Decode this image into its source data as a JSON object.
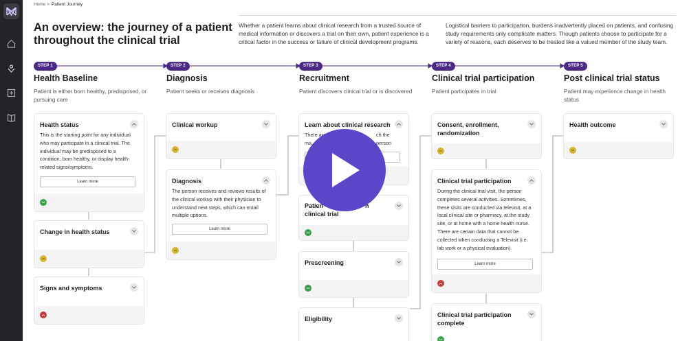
{
  "breadcrumb": {
    "home": "Home >",
    "current": "Patient Journey"
  },
  "header": {
    "title": "An overview: the journey of a patient throughout the clinical trial",
    "intro1": "Whether a patient learns about clinical research from a trusted source of medical information or discovers a trial on their own, patient experience is a critical factor in the success or failure of clinical development programs.",
    "intro2": "Logistical barriers to participation, burdens inadvertently placed on patients, and confusing study requirements only complicate matters. Though patients choose to participate for a variety of reasons, each deserves to be treated like a valued member of the study team."
  },
  "steps": [
    {
      "badge": "STEP 1",
      "title": "Health Baseline",
      "desc": "Patient is either born healthy, predisposed, or pursuing care"
    },
    {
      "badge": "STEP 2",
      "title": "Diagnosis",
      "desc": "Patient seeks or receives diagnosis"
    },
    {
      "badge": "STEP 3",
      "title": "Recruitment",
      "desc": "Patient discovers clinical trial or is discovered"
    },
    {
      "badge": "STEP 4",
      "title": "Clinical trial participation",
      "desc": "Patient participates in trial"
    },
    {
      "badge": "STEP 5",
      "title": "Post clinical trial status",
      "desc": "Patient may experience change in health status"
    }
  ],
  "cards": {
    "health_status": {
      "title": "Health status",
      "body": "This is the starting point for any individual who may participate in a clinical trial. The individual may be predisposed to a condition, born healthy, or display health-related signs/symptoms.",
      "learn": "Learn more",
      "mood": "good"
    },
    "change_health": {
      "title": "Change in health status",
      "mood": "neutral"
    },
    "signs_symptoms": {
      "title": "Signs and symptoms",
      "mood": "bad"
    },
    "clinical_workup": {
      "title": "Clinical workup",
      "mood": "neutral"
    },
    "diagnosis": {
      "title": "Diagnosis",
      "body": "The person receives and reviews results of the clinical workup with their physician to understand next steps, which can entail multiple options.",
      "learn": "Learn more",
      "mood": "neutral"
    },
    "learn_research": {
      "title": "Learn about clinical research",
      "body_visible": "There are",
      "body_visible2": "ch the person",
      "body_visible3": "ma",
      "mood": "good"
    },
    "patient_clinical_trial": {
      "title_part1": "Patien",
      "title_part2": "n",
      "title_line2": "clinical trial",
      "mood": "good"
    },
    "prescreening": {
      "title": "Prescreening",
      "mood": "good"
    },
    "eligibility": {
      "title": "Eligibility"
    },
    "consent": {
      "title": "Consent, enrollment, randomization",
      "mood": "neutral"
    },
    "ct_participation": {
      "title": "Clinical trial participation",
      "body": "During the clinical trial visit, the person completes several activities. Sometimes, these visits are conducted via televisit, at a local clinical site or pharmacy, at the study site, or at home with a home health nurse. There are certain data that cannot be collected when conducting a Televisit (i.e. lab work or a physical evaluation).",
      "learn": "Learn more",
      "mood": "bad"
    },
    "ct_complete": {
      "title": "Clinical trial participation complete",
      "mood": "good"
    },
    "health_outcome": {
      "title": "Health outcome",
      "mood": "neutral"
    }
  },
  "colors": {
    "accent": "#4b2a86",
    "play": "#5b45c8",
    "sidebar": "#222427",
    "good": "#3aa04a",
    "neutral": "#d6b433",
    "bad": "#c23b3b"
  },
  "icons": [
    "app-logo-icon",
    "home-icon",
    "journey-icon",
    "add-panel-icon",
    "book-icon",
    "chevron-down-icon",
    "play-icon"
  ]
}
